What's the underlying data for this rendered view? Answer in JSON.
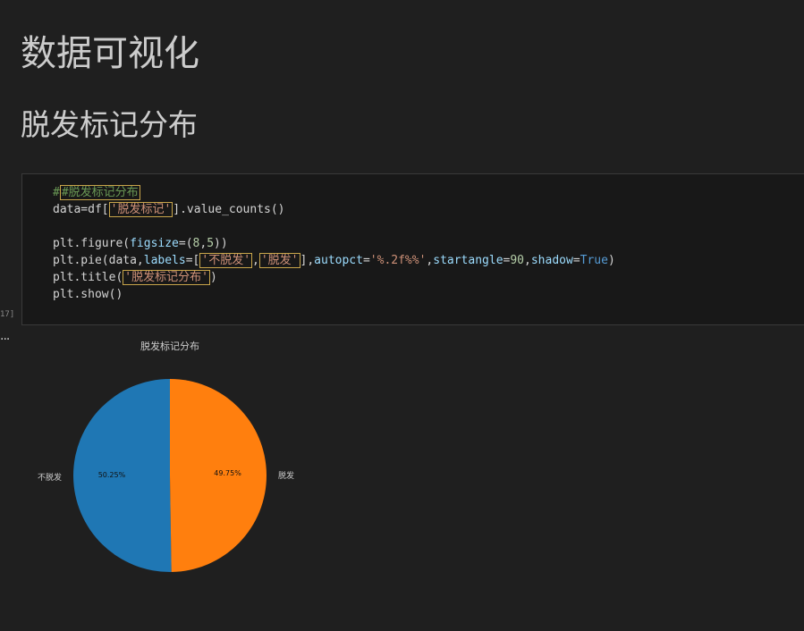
{
  "markdown": {
    "h1": "数据可视化",
    "h2": "脱发标记分布"
  },
  "cell": {
    "execution_count": "17]",
    "code": {
      "comment": "#脱发标记分布",
      "line2_pre": "data=df[",
      "line2_str": "'脱发标记'",
      "line2_post": "].value_counts()",
      "line4_pre": "plt.figure(",
      "line4_param": "figsize",
      "line4_eq": "=(",
      "line4_num1": "8",
      "line4_comma": ",",
      "line4_num2": "5",
      "line4_post": "))",
      "line5_pre": "plt.pie(data,",
      "line5_param1": "labels",
      "line5_eq1": "=[",
      "line5_str1": "'不脱发'",
      "line5_comma": ",",
      "line5_str2": "'脱发'",
      "line5_close": "],",
      "line5_param2": "autopct",
      "line5_eq2": "=",
      "line5_str3": "'%.2f%%'",
      "line5_comma2": ",",
      "line5_param3": "startangle",
      "line5_eq3": "=",
      "line5_num": "90",
      "line5_comma3": ",",
      "line5_param4": "shadow",
      "line5_eq4": "=",
      "line5_kw": "True",
      "line5_post": ")",
      "line6_pre": "plt.title(",
      "line6_str": "'脱发标记分布'",
      "line6_post": ")",
      "line7": "plt.show()"
    }
  },
  "output": {
    "dots": "..."
  },
  "chart_data": {
    "type": "pie",
    "title": "脱发标记分布",
    "labels": [
      "不脱发",
      "脱发"
    ],
    "values": [
      50.25,
      49.75
    ],
    "pct_labels": [
      "50.25%",
      "49.75%"
    ],
    "colors": [
      "#1f77b4",
      "#ff7f0e"
    ],
    "startangle": 90,
    "shadow": true
  }
}
